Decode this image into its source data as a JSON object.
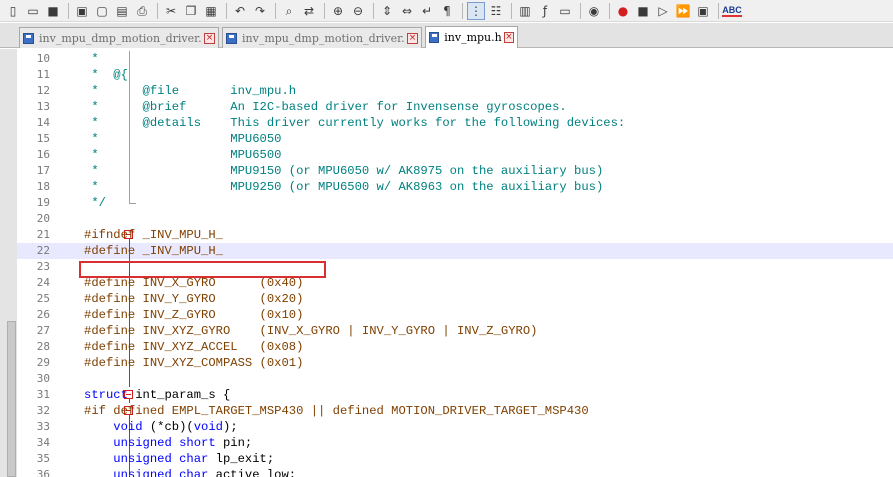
{
  "toolbar": {
    "icons": [
      "new-file-icon",
      "open-folder-icon",
      "save-icon",
      "save-all-icon",
      "close-icon",
      "close-all-icon",
      "print-icon",
      "cut-icon",
      "copy-icon",
      "paste-icon",
      "undo-icon",
      "redo-icon",
      "find-icon",
      "replace-icon",
      "zoom-in-icon",
      "zoom-out-icon",
      "sync-vertical-icon",
      "sync-horizontal-icon",
      "word-wrap-icon",
      "show-all-chars-icon",
      "indent-guide-icon",
      "user-lang-icon",
      "doc-map-icon",
      "function-list-icon",
      "folder-as-workspace-icon",
      "monitoring-icon",
      "record-macro-icon",
      "stop-record-icon",
      "play-macro-icon",
      "run-macro-multiple-icon",
      "save-macro-icon",
      "spell-check-icon"
    ],
    "spellcheck_label": "ABC"
  },
  "tabs": [
    {
      "label": "inv_mpu_dmp_motion_driver.c",
      "active": false
    },
    {
      "label": "inv_mpu_dmp_motion_driver.h",
      "active": false
    },
    {
      "label": "inv_mpu.h",
      "active": true
    }
  ],
  "editor": {
    "current_line": 22,
    "lines": [
      {
        "n": "10",
        "tokens": [
          [
            "comment",
            " *"
          ]
        ]
      },
      {
        "n": "11",
        "tokens": [
          [
            "comment",
            " *  @{"
          ]
        ]
      },
      {
        "n": "12",
        "tokens": [
          [
            "comment",
            " *      @file       inv_mpu.h"
          ]
        ]
      },
      {
        "n": "13",
        "tokens": [
          [
            "comment",
            " *      @brief      An I2C-based driver for Invensense gyroscopes."
          ]
        ]
      },
      {
        "n": "14",
        "tokens": [
          [
            "comment",
            " *      @details    This driver currently works for the following devices:"
          ]
        ]
      },
      {
        "n": "15",
        "tokens": [
          [
            "comment",
            " *                  MPU6050"
          ]
        ]
      },
      {
        "n": "16",
        "tokens": [
          [
            "comment",
            " *                  MPU6500"
          ]
        ]
      },
      {
        "n": "17",
        "tokens": [
          [
            "comment",
            " *                  MPU9150 (or MPU6050 w/ AK8975 on the auxiliary bus)"
          ]
        ]
      },
      {
        "n": "18",
        "tokens": [
          [
            "comment",
            " *                  MPU9250 (or MPU6500 w/ AK8963 on the auxiliary bus)"
          ]
        ]
      },
      {
        "n": "19",
        "tokens": [
          [
            "comment",
            " */"
          ]
        ]
      },
      {
        "n": "20",
        "tokens": []
      },
      {
        "n": "21",
        "tokens": [
          [
            "pre",
            "#ifndef _INV_MPU_H_"
          ]
        ]
      },
      {
        "n": "22",
        "tokens": [
          [
            "pre",
            "#define _INV_MPU_H_"
          ]
        ]
      },
      {
        "n": "23",
        "tokens": []
      },
      {
        "n": "24",
        "tokens": [
          [
            "pre",
            "#define INV_X_GYRO      (0x40)"
          ]
        ]
      },
      {
        "n": "25",
        "tokens": [
          [
            "pre",
            "#define INV_Y_GYRO      (0x20)"
          ]
        ]
      },
      {
        "n": "26",
        "tokens": [
          [
            "pre",
            "#define INV_Z_GYRO      (0x10)"
          ]
        ]
      },
      {
        "n": "27",
        "tokens": [
          [
            "pre",
            "#define INV_XYZ_GYRO    (INV_X_GYRO | INV_Y_GYRO | INV_Z_GYRO)"
          ]
        ]
      },
      {
        "n": "28",
        "tokens": [
          [
            "pre",
            "#define INV_XYZ_ACCEL   (0x08)"
          ]
        ]
      },
      {
        "n": "29",
        "tokens": [
          [
            "pre",
            "#define INV_XYZ_COMPASS (0x01)"
          ]
        ]
      },
      {
        "n": "30",
        "tokens": []
      },
      {
        "n": "31",
        "tokens": [
          [
            "kw",
            "struct"
          ],
          [
            "text",
            " int_param_s {"
          ]
        ]
      },
      {
        "n": "32",
        "tokens": [
          [
            "pre",
            "#if defined EMPL_TARGET_MSP430 || defined MOTION_DRIVER_TARGET_MSP430"
          ]
        ]
      },
      {
        "n": "33",
        "tokens": [
          [
            "text",
            "    "
          ],
          [
            "kw",
            "void"
          ],
          [
            "text",
            " (*cb)("
          ],
          [
            "kw",
            "void"
          ],
          [
            "text",
            ");"
          ]
        ]
      },
      {
        "n": "34",
        "tokens": [
          [
            "text",
            "    "
          ],
          [
            "kw",
            "unsigned short"
          ],
          [
            "text",
            " pin;"
          ]
        ]
      },
      {
        "n": "35",
        "tokens": [
          [
            "text",
            "    "
          ],
          [
            "kw",
            "unsigned char"
          ],
          [
            "text",
            " lp_exit;"
          ]
        ]
      },
      {
        "n": "36",
        "tokens": [
          [
            "text",
            "    "
          ],
          [
            "kw",
            "unsigned char"
          ],
          [
            "text",
            " active_low;"
          ]
        ]
      }
    ]
  },
  "colors": {
    "comment": "#008080",
    "preprocessor": "#804000",
    "keyword": "#0000ff",
    "current_line": "#e8e8ff",
    "annotation_box": "#d83030"
  }
}
